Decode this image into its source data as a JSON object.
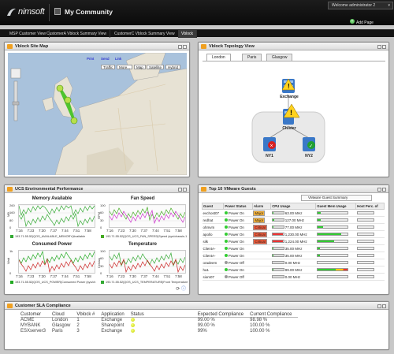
{
  "header": {
    "logo": "nimsoft",
    "title": "My Community",
    "welcome": "Welcome administrator 2",
    "add_page": "Add Page"
  },
  "tabs": [
    {
      "label": "MSP Customer View"
    },
    {
      "label": "CustomerA Vblock Summary View"
    },
    {
      "label": "CustomerC Vblock Summary View"
    },
    {
      "label": "Vblock"
    }
  ],
  "map_panel": {
    "title": "Vblock Site Map",
    "links": [
      "Print",
      "Send",
      "Link"
    ],
    "buttons": [
      "Traffic",
      "More...",
      "Map",
      "Satellite",
      "Hybrid"
    ]
  },
  "topology": {
    "title": "Vblock Topology View",
    "tabs": [
      "London",
      "Paris",
      "Glasgow"
    ],
    "nodes": {
      "exchange": "Exchange",
      "cluster": "Cluster",
      "ny1": "NY1",
      "ny2": "NY2"
    }
  },
  "ucs": {
    "title": "UCS Environmental Performance",
    "charts": [
      {
        "title": "Memory Available",
        "yunit": "MB",
        "yticks": [
          "260",
          "160",
          "80",
          "0"
        ],
        "xticks": [
          "7:16",
          "7:23",
          "7:30",
          "7:37",
          "7:44",
          "7:51",
          "7:58"
        ],
        "legend": "193.71.55.52|QOS_AVAILABLE_MEMORY|Available"
      },
      {
        "title": "Fan Speed",
        "yunit": "RPM",
        "yticks": [
          "100",
          "60",
          "30",
          "0"
        ],
        "xticks": [
          "7:16",
          "7:23",
          "7:30",
          "7:37",
          "7:44",
          "7:51",
          "7:58"
        ],
        "legend": "193.71.55.52|QOS_UCS_FAN_SPEED|Speed (sys/chassis-1"
      },
      {
        "title": "Consumed Power",
        "yunit": "Watt",
        "yticks": [
          "1k",
          "0"
        ],
        "xticks": [
          "7:16",
          "7:23",
          "7:30",
          "7:37",
          "7:44",
          "7:51",
          "7:58"
        ],
        "legend": "193.71.55.52|QOS_UCS_POWER|Consumed Power (sys/ch"
      },
      {
        "title": "Temperature",
        "yunit": "Celsius",
        "yticks": [
          "100",
          "60",
          "30",
          "0"
        ],
        "xticks": [
          "7:16",
          "7:23",
          "7:30",
          "7:37",
          "7:44",
          "7:51",
          "7:58"
        ],
        "legend": "193.71.55.52|QOS_UCS_TEMPERATURE|Front Temperature"
      }
    ]
  },
  "vmware": {
    "title": "Top 10 VMware Guests",
    "dropdown": "VMware Guest Summary",
    "columns": [
      "Guest",
      "Power Status",
      "Alarm",
      "CPU Usage",
      "Guest Mem Usage",
      "Host Perc. of"
    ],
    "rows": [
      {
        "guest": "evchost07",
        "power": "Power On",
        "alarm": "Major",
        "cpu": "63.00 MHz"
      },
      {
        "guest": "redhat",
        "power": "Power On",
        "alarm": "Major",
        "cpu": "127.00 MHz"
      },
      {
        "guest": "ohmvm",
        "power": "Power On",
        "alarm": "Critical",
        "cpu": "77.00 MHz"
      },
      {
        "guest": "apollo",
        "power": "Power On",
        "alarm": "Critical",
        "cpu": "1,230.00 MHz"
      },
      {
        "guest": "silk",
        "power": "Power On",
        "alarm": "Critical",
        "cpu": "1,224.00 MHz"
      },
      {
        "guest": "ClientA-",
        "power": "Power On",
        "alarm": "",
        "cpu": "35.00 MHz"
      },
      {
        "guest": "ClientA-",
        "power": "Power On",
        "alarm": "",
        "cpu": "35.00 MHz"
      },
      {
        "guest": "oradeem",
        "power": "Power Off",
        "alarm": "",
        "cpu": "0.00 MHz"
      },
      {
        "guest": "ha1",
        "power": "Power On",
        "alarm": "",
        "cpu": "99.00 MHz"
      },
      {
        "guest": "siom07",
        "power": "Power Off",
        "alarm": "",
        "cpu": "0.00 MHz"
      }
    ]
  },
  "sla": {
    "title": "Customer SLA Compliance",
    "columns": [
      "Customer",
      "Cloud",
      "Vblock #",
      "Application",
      "Status",
      "Expected Compliance",
      "Current Compliance"
    ],
    "rows": [
      {
        "customer": "ACME",
        "cloud": "London",
        "vblock": "1",
        "app": "Exchange",
        "expected": "99.00 %",
        "current": "98.98 %"
      },
      {
        "customer": "MYBANK",
        "cloud": "Glasgow",
        "vblock": "2",
        "app": "Sharepoint",
        "expected": "99.00 %",
        "current": "100.00 %"
      },
      {
        "customer": "ESXserver3",
        "cloud": "Paris",
        "vblock": "3",
        "app": "Exchange",
        "expected": "99%",
        "current": "100.00 %"
      }
    ]
  }
}
